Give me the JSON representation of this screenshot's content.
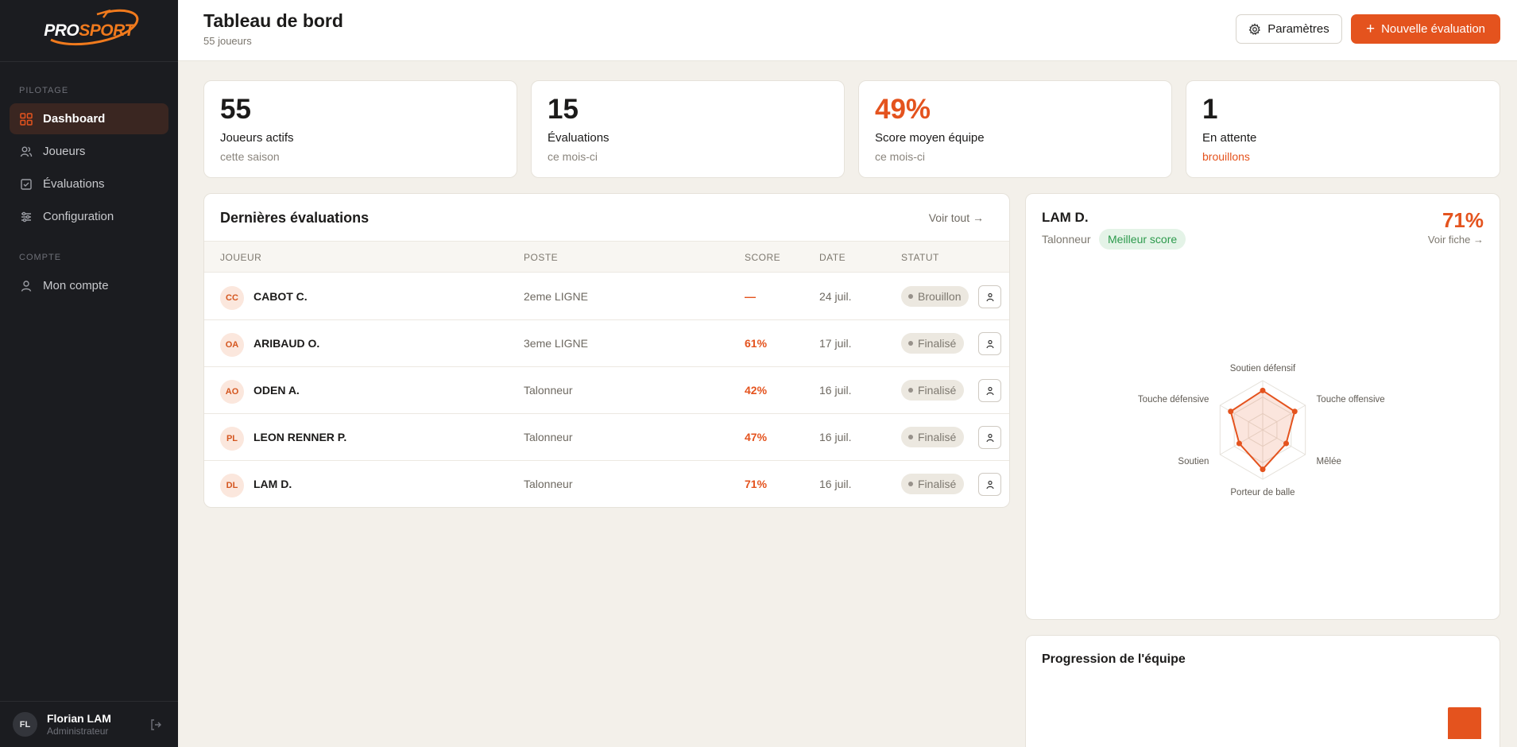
{
  "sidebar": {
    "logo": {
      "part1": "PRO",
      "part2": "SPORT"
    },
    "sections": [
      {
        "title": "PILOTAGE",
        "items": [
          {
            "label": "Dashboard",
            "icon": "dashboard-icon",
            "active": true
          },
          {
            "label": "Joueurs",
            "icon": "users-icon"
          },
          {
            "label": "Évaluations",
            "icon": "checklist-icon"
          },
          {
            "label": "Configuration",
            "icon": "sliders-icon"
          }
        ]
      },
      {
        "title": "COMPTE",
        "items": [
          {
            "label": "Mon compte",
            "icon": "user-icon"
          }
        ]
      }
    ],
    "user": {
      "initials": "FL",
      "name": "Florian LAM",
      "role": "Administrateur"
    }
  },
  "header": {
    "title": "Tableau de bord",
    "subtitle": "55 joueurs",
    "settings_label": "Paramètres",
    "new_label": "Nouvelle évaluation"
  },
  "stats": [
    {
      "value": "55",
      "label": "Joueurs actifs",
      "sub": "cette saison"
    },
    {
      "value": "15",
      "label": "Évaluations",
      "sub": "ce mois-ci"
    },
    {
      "value": "49%",
      "label": "Score moyen équipe",
      "sub": "ce mois-ci"
    },
    {
      "value": "1",
      "label": "En attente",
      "sub": "brouillons"
    }
  ],
  "evaluations": {
    "title": "Dernières évaluations",
    "see_all": "Voir tout →",
    "columns": [
      "JOUEUR",
      "POSTE",
      "SCORE",
      "DATE",
      "STATUT"
    ],
    "rows": [
      {
        "initials": "CC",
        "name": "CABOT C.",
        "position": "2eme LIGNE",
        "score": "—",
        "date": "24 juil.",
        "status": "Brouillon"
      },
      {
        "initials": "OA",
        "name": "ARIBAUD O.",
        "position": "3eme LIGNE",
        "score": "61%",
        "date": "17 juil.",
        "status": "Finalisé"
      },
      {
        "initials": "AO",
        "name": "ODEN A.",
        "position": "Talonneur",
        "score": "42%",
        "date": "16 juil.",
        "status": "Finalisé"
      },
      {
        "initials": "PL",
        "name": "LEON RENNER P.",
        "position": "Talonneur",
        "score": "47%",
        "date": "16 juil.",
        "status": "Finalisé"
      },
      {
        "initials": "DL",
        "name": "LAM D.",
        "position": "Talonneur",
        "score": "71%",
        "date": "16 juil.",
        "status": "Finalisé"
      }
    ]
  },
  "best_player": {
    "name": "LAM D.",
    "position": "Talonneur",
    "badge": "Meilleur score",
    "score": "71%",
    "link": "Voir fiche →"
  },
  "chart_data": {
    "type": "radar",
    "axes": [
      "Soutien défensif",
      "Touche offensive",
      "Mêlée",
      "Porteur de balle",
      "Soutien",
      "Touche défensive"
    ],
    "values": [
      0.8,
      0.75,
      0.55,
      0.8,
      0.55,
      0.75
    ],
    "range": [
      0,
      1
    ],
    "color": "#e4531e"
  },
  "progression": {
    "title": "Progression de l'équipe"
  },
  "colors": {
    "accent": "#e4531e",
    "sidebar": "#1b1c20",
    "success": "#2c9a4c"
  }
}
